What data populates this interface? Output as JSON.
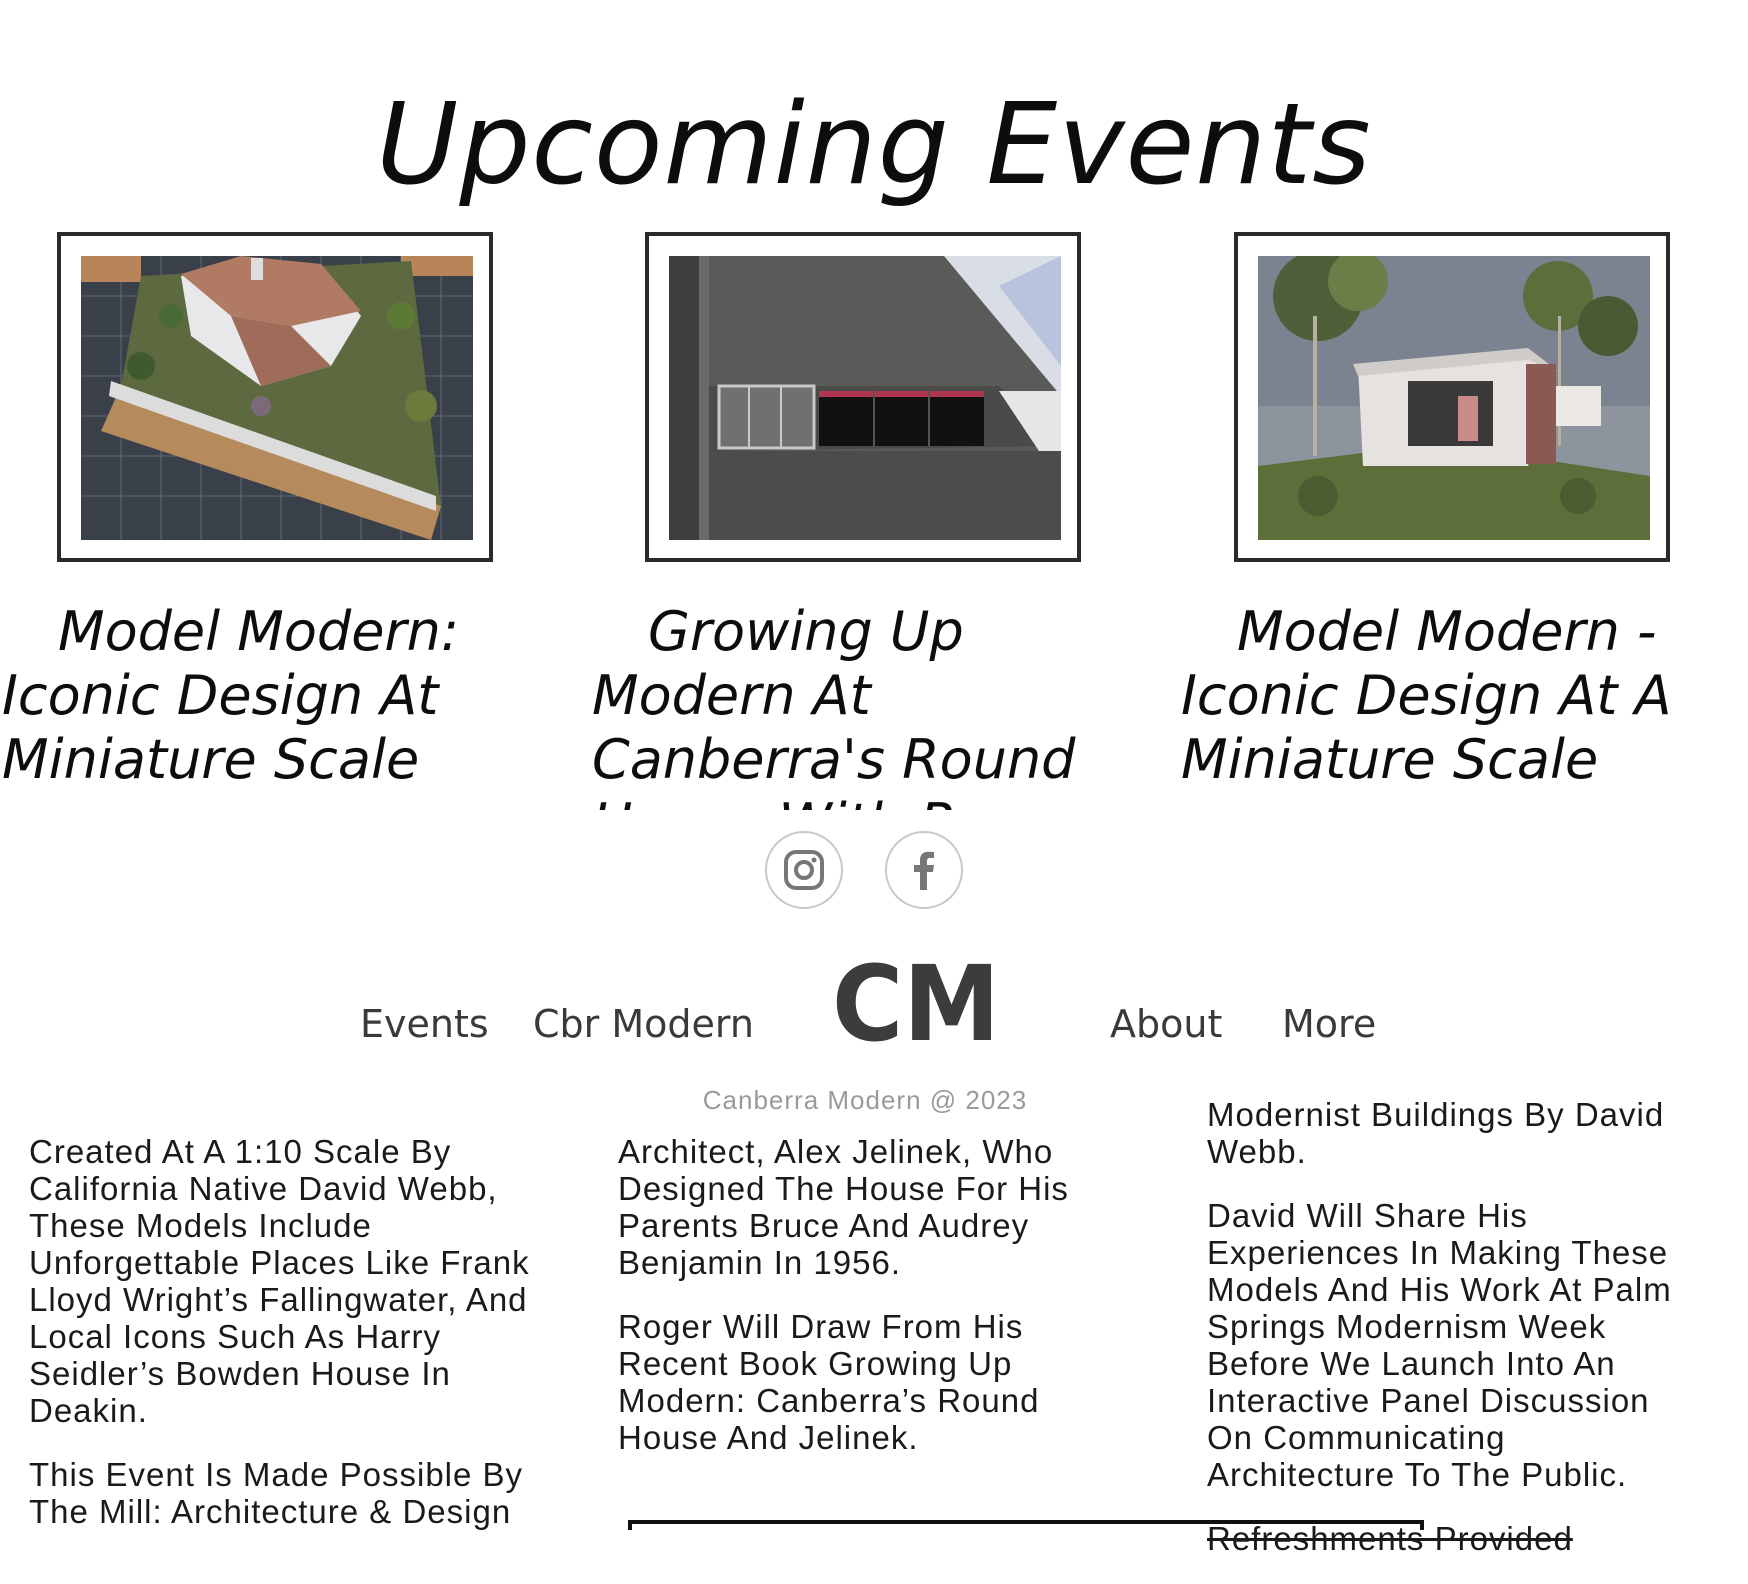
{
  "page": {
    "title": "Upcoming Events"
  },
  "events": [
    {
      "title": "Model Modern: Iconic Design At Miniature Scale"
    },
    {
      "title": "Growing Up Modern At Canberra's Round House With Roger Benjamin"
    },
    {
      "title": "Model Modern - Iconic Design At A Miniature Scale"
    }
  ],
  "social": {
    "items": [
      "instagram-icon",
      "facebook-icon"
    ]
  },
  "nav": {
    "events": "Events",
    "cbr_modern": "Cbr Modern",
    "about": "About",
    "more": "More",
    "logo": "CM"
  },
  "footer": {
    "copyright": "Canberra Modern @ 2023"
  },
  "descriptions": {
    "col1": {
      "p1": "Created At A 1:10 Scale By California Native David Webb, These Models Include Unforgettable Places Like Frank Lloyd Wright’s Fallingwater, And Local Icons Such As Harry Seidler’s Bowden House In Deakin.",
      "p2": "This Event Is Made Possible By The Mill: Architecture & Design"
    },
    "col2": {
      "p1": "Architect, Alex Jelinek, Who Designed The House For His Parents Bruce And Audrey Benjamin In 1956.",
      "p2": "Roger Will Draw From His Recent Book Growing Up Modern: Canberra’s Round House And Jelinek."
    },
    "col3": {
      "p0": "Modernist Buildings By David Webb.",
      "p1": "David Will Share His Experiences In Making These Models And His Work At Palm Springs Modernism Week Before We Launch Into An Interactive Panel Discussion On Communicating Architecture To The Public.",
      "p2": "Refreshments Provided"
    }
  },
  "colors": {
    "frame": "#2a2a2a",
    "nav": "#3a3a3a",
    "muted": "#9a9a9a",
    "logo": "#3d3b3c"
  }
}
